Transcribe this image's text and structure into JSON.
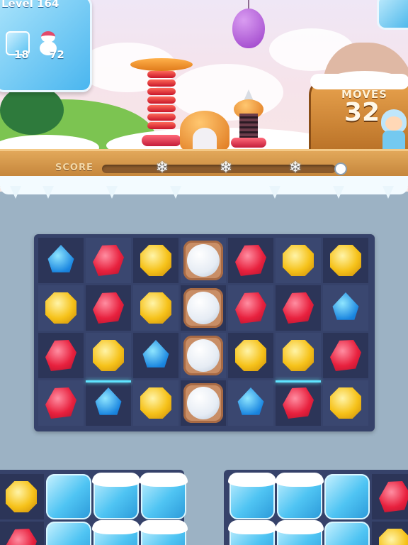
{
  "hud": {
    "level_label": "Level 164",
    "goal_ice": "18",
    "goal_snowman": "72",
    "moves_label": "MOVES",
    "moves_value": "32",
    "score_label": "SCORE",
    "score_progress": 0.0,
    "score_star_count": 3
  },
  "icons": {
    "goal_ice": "ice-cube-icon",
    "goal_snowman": "snowman-icon",
    "booster_balloon": "balloon-icon",
    "booster_spring": "spring-icon",
    "booster_dome": "dome-icon",
    "booster_drill": "drill-icon",
    "player": "avatar-icon"
  },
  "colors": {
    "board_bg": "#36426a",
    "gem_blue": "#1a86e0",
    "gem_red": "#e8213e",
    "gem_yellow": "#f6c21a",
    "highlight": "#5fe4ff"
  },
  "board": {
    "rows": [
      [
        "blue",
        "red",
        "yellow",
        "snowball",
        "red",
        "yellow",
        "yellow"
      ],
      [
        "yellow",
        "red",
        "yellow",
        "snowball",
        "red",
        "red",
        "blue"
      ],
      [
        "red",
        "yellow",
        "blue",
        "snowball",
        "yellow",
        "yellow",
        "red"
      ],
      [
        "red",
        "blue",
        "yellow",
        "snowball",
        "blue",
        "red",
        "yellow"
      ]
    ],
    "highlighted": [
      [
        3,
        1
      ],
      [
        3,
        5
      ]
    ]
  },
  "lower_left": {
    "rows": [
      [
        "yellow",
        "ice",
        "ice-snow",
        "ice-snow"
      ],
      [
        "red",
        "ice",
        "ice-snow",
        "ice-snow"
      ]
    ]
  },
  "lower_right": {
    "rows": [
      [
        "ice-snow",
        "ice-snow",
        "ice",
        "red"
      ],
      [
        "ice-snow",
        "ice-snow",
        "ice",
        "yellow"
      ]
    ]
  }
}
